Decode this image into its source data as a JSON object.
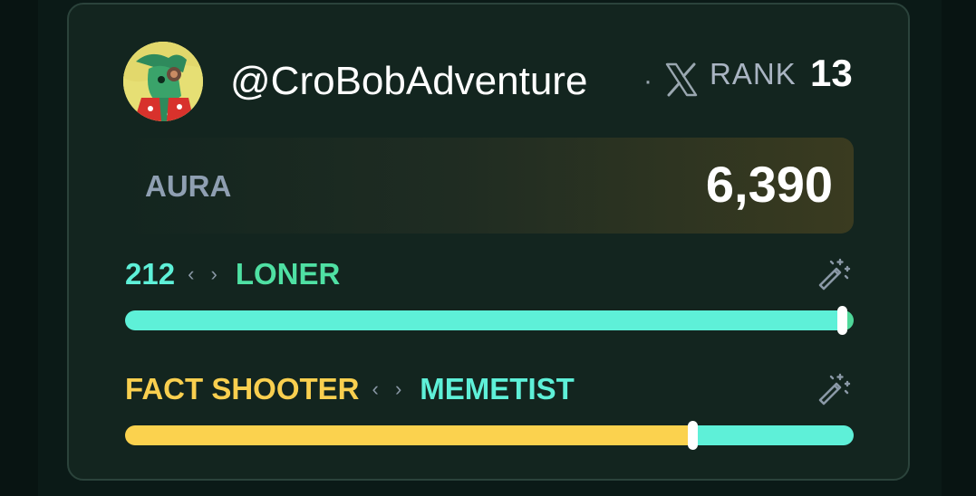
{
  "profile": {
    "handle": "@CroBobAdventure",
    "separator": "·",
    "platform_icon": "x-logo-icon",
    "rank_label": "RANK",
    "rank_value": "13"
  },
  "aura": {
    "label": "AURA",
    "value": "6,390"
  },
  "traits": [
    {
      "left_label": "212",
      "right_label": "LONER",
      "arrows": "‹ ›",
      "left_color": "#5ef0d8",
      "right_color": "#4fe0a3",
      "icon": "magic-wand-icon",
      "position": 0.985,
      "left_fill_color": "#5ef0d8",
      "right_fill_color": "#4fd89a"
    },
    {
      "left_label": "FACT SHOOTER",
      "right_label": "MEMETIST",
      "arrows": "‹ ›",
      "left_color": "#f9cf4f",
      "right_color": "#5ef0d8",
      "icon": "magic-wand-icon",
      "position": 0.78,
      "left_fill_color": "#fbd24e",
      "right_fill_color": "#5ef0d8"
    }
  ]
}
